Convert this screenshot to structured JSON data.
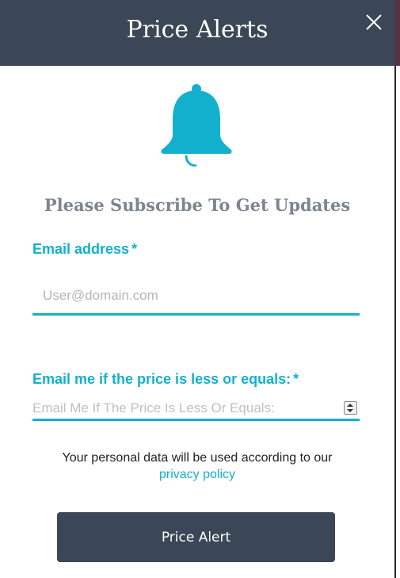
{
  "modal": {
    "title": "Price Alerts",
    "close_icon": "close-icon",
    "bell_icon": "bell-icon",
    "subtitle": "Please Subscribe To Get Updates"
  },
  "form": {
    "email": {
      "label": "Email address",
      "required_mark": "*",
      "placeholder": "User@domain.com",
      "value": ""
    },
    "price": {
      "label": "Email me if the price is less or equals:",
      "required_mark": "*",
      "placeholder": "Email Me If The Price Is Less Or Equals:",
      "value": ""
    },
    "consent_text": "Your personal data will be used according to our",
    "privacy_link": "privacy policy",
    "submit_label": "Price Alert"
  },
  "colors": {
    "header_bg": "#3b4656",
    "accent": "#13b0cd",
    "subtitle": "#7d8590",
    "button_bg": "#3b4656"
  }
}
